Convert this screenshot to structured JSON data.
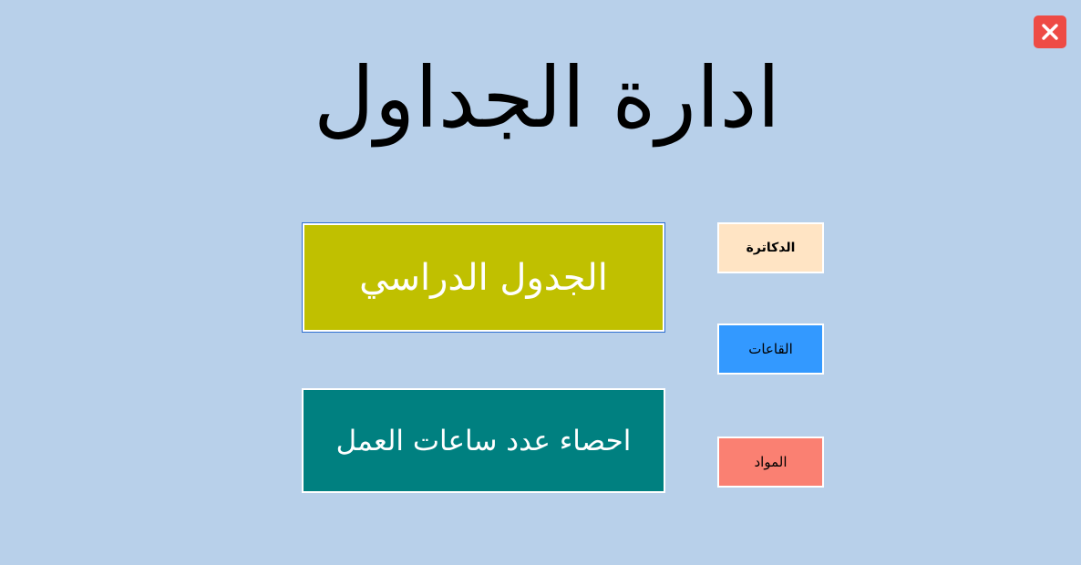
{
  "window": {
    "close_icon": "close-icon"
  },
  "page": {
    "title": "ادارة الجداول"
  },
  "buttons": {
    "schedule": "الجدول الدراسي",
    "work_hours_stats": "احصاء عدد ساعات العمل",
    "doctors": "الدكاترة",
    "halls": "القاعات",
    "courses": "المواد"
  },
  "colors": {
    "background": "#b8d0ea",
    "close": "#ee4b45",
    "schedule": "#c0c000",
    "stats": "#008080",
    "doctors": "#ffe4c4",
    "halls": "#3399ff",
    "courses": "#fa8072"
  }
}
